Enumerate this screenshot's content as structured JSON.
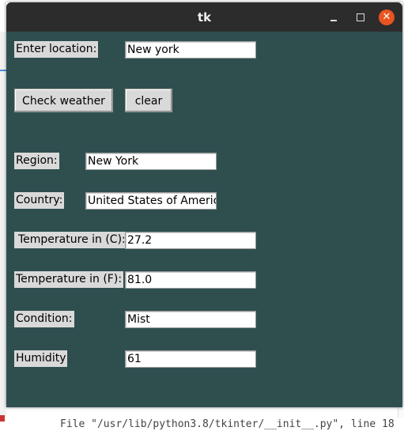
{
  "window": {
    "title": "tk"
  },
  "form": {
    "location_label": "Enter location:",
    "location_value": "New york",
    "check_button": "Check weather",
    "clear_button": "clear"
  },
  "results": {
    "region_label": "Region:",
    "region_value": "New York",
    "country_label": "Country:",
    "country_value": "United States of America",
    "temp_c_label": "Temperature in (C):",
    "temp_c_value": "27.2",
    "temp_f_label": "Temperature in (F):",
    "temp_f_value": "81.0",
    "condition_label": "Condition:",
    "condition_value": "Mist",
    "humidity_label": "Humidity",
    "humidity_value": "61"
  },
  "background": {
    "bottom_text": "File \"/usr/lib/python3.8/tkinter/__init__.py\", line 18"
  },
  "colors": {
    "content_bg": "#2f4f4f",
    "titlebar_bg": "#2c2c2c",
    "close_button": "#e95420",
    "widget_bg": "#d9d9d9"
  }
}
